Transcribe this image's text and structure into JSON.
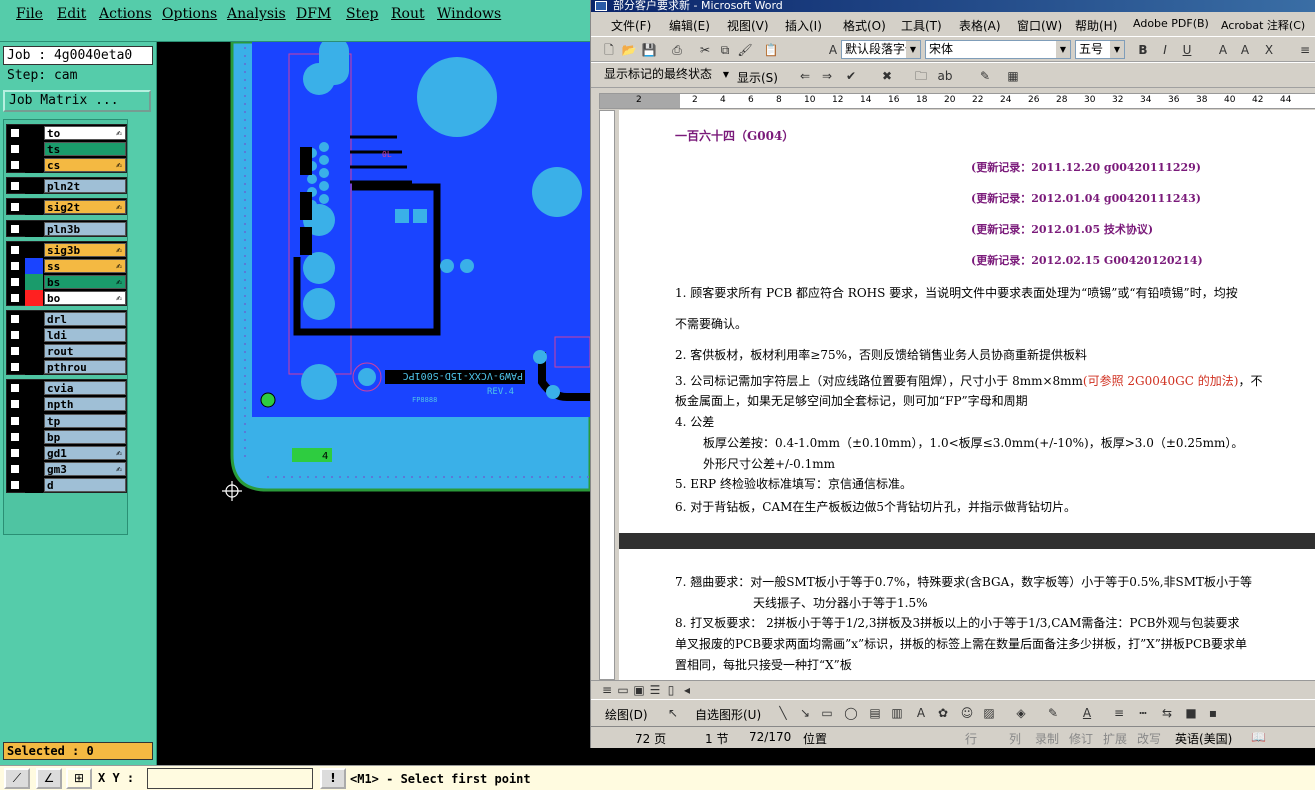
{
  "cam": {
    "menu": [
      "File",
      "Edit",
      "Actions",
      "Options",
      "Analysis",
      "DFM",
      "Step",
      "Rout",
      "Windows"
    ],
    "job_label": "Job : 4g0040eta0",
    "step_label": "Step: cam",
    "job_matrix_button": "Job Matrix ...",
    "layers": [
      {
        "name": "to",
        "swatch": "#000000",
        "bg": "#ffffff",
        "hand": "✍",
        "group": 0
      },
      {
        "name": "ts",
        "swatch": "#000000",
        "bg": "#1a9b6b",
        "hand": "",
        "group": 0
      },
      {
        "name": "cs",
        "swatch": "#000000",
        "bg": "#f4b942",
        "hand": "✍",
        "group": 0
      },
      {
        "name": "pln2t",
        "swatch": "#000000",
        "bg": "#9fbfd6",
        "hand": "",
        "group": 1
      },
      {
        "name": "sig2t",
        "swatch": "#000000",
        "bg": "#f4b942",
        "hand": "✍",
        "group": 2
      },
      {
        "name": "pln3b",
        "swatch": "#000000",
        "bg": "#9fbfd6",
        "hand": "",
        "group": 3
      },
      {
        "name": "sig3b",
        "swatch": "#000000",
        "bg": "#f4b942",
        "hand": "✍",
        "group": 4
      },
      {
        "name": "ss",
        "swatch": "#1a44ff",
        "bg": "#f4b942",
        "hand": "✍",
        "group": 4
      },
      {
        "name": "bs",
        "swatch": "#1a9b6b",
        "bg": "#1a9b6b",
        "hand": "✍",
        "group": 4
      },
      {
        "name": "bo",
        "swatch": "#ff2020",
        "bg": "#ffffff",
        "hand": "✍",
        "group": 4
      },
      {
        "name": "drl",
        "swatch": "#000000",
        "bg": "#9fbfd6",
        "hand": "",
        "group": 5
      },
      {
        "name": "ldi",
        "swatch": "#000000",
        "bg": "#9fbfd6",
        "hand": "",
        "group": 5
      },
      {
        "name": "rout",
        "swatch": "#000000",
        "bg": "#9fbfd6",
        "hand": "",
        "group": 5
      },
      {
        "name": "pthrou",
        "swatch": "#000000",
        "bg": "#9fbfd6",
        "hand": "",
        "group": 5
      },
      {
        "name": "cvia",
        "swatch": "#000000",
        "bg": "#9fbfd6",
        "hand": "",
        "group": 6
      },
      {
        "name": "npth",
        "swatch": "#000000",
        "bg": "#9fbfd6",
        "hand": "",
        "group": 6
      },
      {
        "name": "tp",
        "swatch": "#000000",
        "bg": "#9fbfd6",
        "hand": "",
        "group": 6
      },
      {
        "name": "bp",
        "swatch": "#000000",
        "bg": "#9fbfd6",
        "hand": "",
        "group": 6
      },
      {
        "name": "gd1",
        "swatch": "#000000",
        "bg": "#9fbfd6",
        "hand": "✍",
        "group": 6
      },
      {
        "name": "gm3",
        "swatch": "#000000",
        "bg": "#9fbfd6",
        "hand": "✍",
        "group": 6
      },
      {
        "name": "d",
        "swatch": "#000000",
        "bg": "#9fbfd6",
        "hand": "",
        "group": 6
      }
    ],
    "selected_label": "Selected : 0",
    "board_text_1": "PAW9-VCXX-15D-S001PC",
    "board_text_2": "REV.4",
    "board_text_3": "FP8888",
    "board_text_4": "0L",
    "board_pad_label": "4",
    "status": {
      "xy_label": "X Y :",
      "xy_value": "",
      "warn_icon": "!",
      "message": "<M1> - Select first point"
    }
  },
  "word": {
    "title": "部分客户要求新 - Microsoft Word",
    "menu": [
      "文件(F)",
      "编辑(E)",
      "视图(V)",
      "插入(I)",
      "格式(O)",
      "工具(T)",
      "表格(A)",
      "窗口(W)",
      "帮助(H)",
      "Adobe PDF(B)",
      "Acrobat 注释(C)"
    ],
    "style_combo": "默认段落字体",
    "font_combo": "宋体",
    "size_combo": "五号",
    "markup_combo": "显示标记的最终状态",
    "show_menu": "显示(S)",
    "ruler_ticks": [
      "2",
      "2",
      "4",
      "6",
      "8",
      "10",
      "12",
      "14",
      "16",
      "18",
      "20",
      "22",
      "24",
      "26",
      "28",
      "30",
      "32",
      "34",
      "36",
      "38",
      "40",
      "42",
      "44"
    ],
    "doc": {
      "heading": "一百六十四（G004）",
      "records": [
        "(更新记录：2011.12.20    g00420111229)",
        "(更新记录：2012.01.04    g00420111243)",
        "(更新记录：2012.01.05        技术协议)",
        "(更新记录：2012.02.15          G00420120214)"
      ],
      "p1a": "1. 顾客要求所有 PCB 都应符合 ROHS 要求，当说明文件中要求表面处理为“喷锡”或“有铅喷锡”时，均按",
      "p1b": "不需要确认。",
      "p2": "2.     客供板材，板材利用率≥75%，否则反馈给销售业务人员协商重新提供板料",
      "p3a_1": "3. 公司标记需加字符层上（对应线路位置要有阻焊），尺寸小于 8mm×8mm",
      "p3a_red": "(可参照 2G0040GC 的加法)",
      "p3a_2": "，不",
      "p3b": "板金属面上，如果无足够空间加全套标记，则可加“FP”字母和周期",
      "p4": "4.  公差",
      "p4a": "板厚公差按：0.4-1.0mm（±0.10mm），1.0<板厚≤3.0mm(+/-10%)，板厚>3.0（±0.25mm）。",
      "p4b": "外形尺寸公差+/-0.1mm",
      "p5": "5.  ERP 终检验收标准填写：京信通信标准。",
      "p6": "6.   对于背钻板，CAM在生产板板边做5个背钻切片孔，并指示做背钻切片。",
      "p7": "7.    翘曲要求：对一般SMT板小于等于0.7%，特殊要求(含BGA，数字板等）小于等于0.5%,非SMT板小于等",
      "p7b": "天线振子、功分器小于等于1.5%",
      "p8": "8.    打叉板要求：  2拼板小于等于1/2,3拼板及3拼板以上的小于等于1/3,CAM需备注：PCB外观与包装要求",
      "p8b": "单叉报废的PCB要求两面均需画”x”标识，拼板的标签上需在数量后面备注多少拼板，打”X”拼板PCB要求单",
      "p8c": "置相同，每批只接受一种打“X”板"
    },
    "draw_label": "绘图(D)",
    "autoshape_label": "自选图形(U)",
    "status": {
      "page": "72 页",
      "section": "1 节",
      "page_of": "72/170",
      "position": "位置",
      "line": "行",
      "col": "列",
      "rec": "录制",
      "trk": "修订",
      "ext": "扩展",
      "ovr": "改写",
      "lang": "英语(美国)"
    }
  },
  "colors": {
    "cam_bg": "#55ccaa",
    "board_blue": "#1a44ff",
    "board_cyan": "#3ab0e8",
    "board_green": "#1a9b6b"
  }
}
